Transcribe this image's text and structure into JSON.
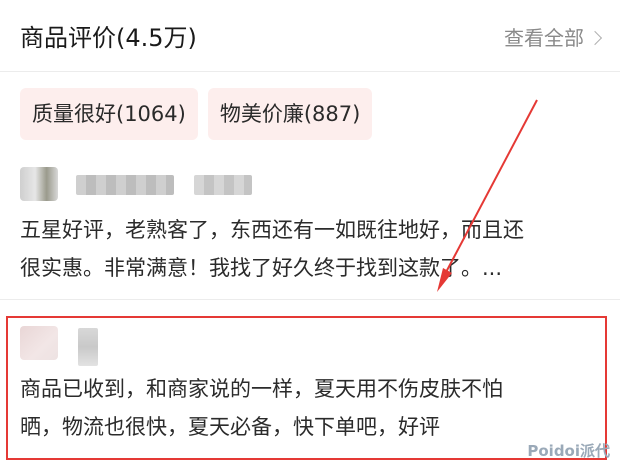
{
  "header": {
    "title": "商品评价(4.5万)",
    "view_all": "查看全部"
  },
  "tags": [
    {
      "label": "质量很好(1064)"
    },
    {
      "label": "物美价廉(887)"
    }
  ],
  "reviews": [
    {
      "text_line1": "五星好评，老熟客了，东西还有一如既往地好，而且还",
      "text_line2": "很实惠。非常满意！我找了好久终于找到这款了。..."
    },
    {
      "text_line1": "商品已收到，和商家说的一样，夏天用不伤皮肤不怕",
      "text_line2": "晒，物流也很快，夏天必备，快下单吧，好评"
    }
  ],
  "watermark": "Poidoi派代",
  "colors": {
    "tag_bg": "#fdeeed",
    "highlight": "#e53935"
  }
}
